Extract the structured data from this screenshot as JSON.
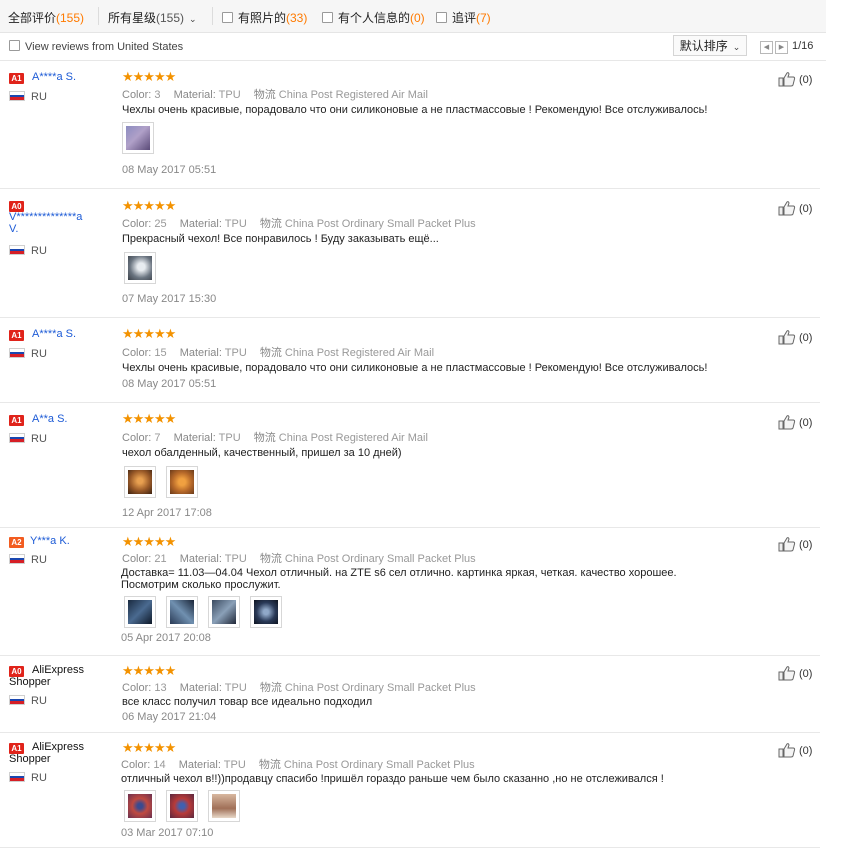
{
  "filters": {
    "all_label": "全部评价",
    "all_count": "(155)",
    "stars_label": "所有星级",
    "stars_count": "(155)",
    "photos_label": "有照片的",
    "photos_count": "(33)",
    "personal_label": "有个人信息的",
    "personal_count": "(0)",
    "followup_label": "追评",
    "followup_count": "(7)"
  },
  "toolbar": {
    "view_us_label": "View reviews from United States",
    "sort_label": "默认排序",
    "prev_icon": "◀",
    "next_icon": "▶",
    "page_text": "1/16"
  },
  "labels": {
    "color": "Color:",
    "material": "Material:",
    "shipping": "物流"
  },
  "colors": {
    "accent": "#ff7a00",
    "stars": "#f39200",
    "name_blue": "#1d5bd6",
    "badge_red": "#e0231a"
  },
  "reviews": [
    {
      "badge": "A1",
      "name": "A****a S.",
      "country": "RU",
      "stars": "★★★★★",
      "color": "3",
      "material": "TPU",
      "shipping": "China Post Registered Air Mail",
      "text": "Чехлы очень красивые, порадовало что они силиконовые а не пластмассовые ! Рекомендую! Все отслуживалось!",
      "date": "08 May 2017 05:51",
      "likes": "(0)"
    },
    {
      "badge": "A0",
      "name": "V**************a",
      "name2": "V.",
      "country": "RU",
      "stars": "★★★★★",
      "color": "25",
      "material": "TPU",
      "shipping": "China Post Ordinary Small Packet Plus",
      "text": "Прекрасный чехол! Все понравилось ! Буду заказывать ещё...",
      "date": "07 May 2017 15:30",
      "likes": "(0)"
    },
    {
      "badge": "A1",
      "name": "A****a S.",
      "country": "RU",
      "stars": "★★★★★",
      "color": "15",
      "material": "TPU",
      "shipping": "China Post Registered Air Mail",
      "text": "Чехлы очень красивые, порадовало что они силиконовые а не пластмассовые ! Рекомендую! Все отслуживалось!",
      "date": "08 May 2017 05:51",
      "likes": "(0)"
    },
    {
      "badge": "A1",
      "name": "A**a S.",
      "country": "RU",
      "stars": "★★★★★",
      "color": "7",
      "material": "TPU",
      "shipping": "China Post Registered Air Mail",
      "text": "чехол обалденный, качественный, пришел за 10 дней)",
      "date": "12 Apr 2017 17:08",
      "likes": "(0)"
    },
    {
      "badge": "A2",
      "name": "Y***a K.",
      "country": "RU",
      "stars": "★★★★★",
      "color": "21",
      "material": "TPU",
      "shipping": "China Post Ordinary Small Packet Plus",
      "text": "Доставка= 11.03—04.04 Чехол отличный. на ZTE s6 сел отлично. картинка яркая, четкая. качество хорошее.",
      "text2": "Посмотрим сколько прослужит.",
      "date": "05 Apr 2017 20:08",
      "likes": "(0)"
    },
    {
      "badge": "A0",
      "name": "AliExpress",
      "name2": "Shopper",
      "country": "RU",
      "stars": "★★★★★",
      "color": "13",
      "material": "TPU",
      "shipping": "China Post Ordinary Small Packet Plus",
      "text": "все класс получил товар все идеально подходил",
      "date": "06 May 2017 21:04",
      "likes": "(0)"
    },
    {
      "badge": "A1",
      "name": "AliExpress",
      "name2": "Shopper",
      "country": "RU",
      "stars": "★★★★★",
      "color": "14",
      "material": "TPU",
      "shipping": "China Post Ordinary Small Packet Plus",
      "text": "отличный чехол в!!))продавцу спасибо !пришёл гораздо раньше чем было сказанно ,но не отслеживался !",
      "date": "03 Mar 2017 07:10",
      "likes": "(0)"
    }
  ]
}
